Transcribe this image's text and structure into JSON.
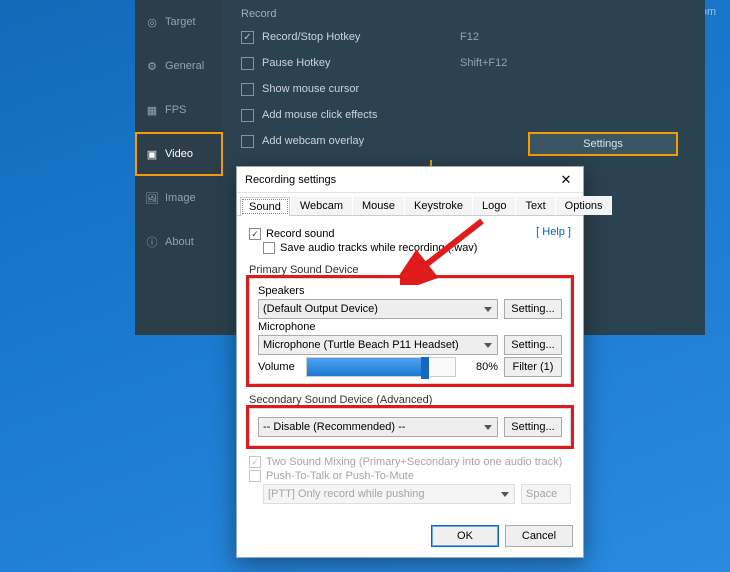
{
  "watermark": "www.bandicam.com",
  "sidebar": {
    "items": [
      {
        "label": "Target"
      },
      {
        "label": "General"
      },
      {
        "label": "FPS"
      },
      {
        "label": "Video"
      },
      {
        "label": "Image"
      },
      {
        "label": "About"
      }
    ]
  },
  "record_section": {
    "title": "Record",
    "rows": [
      {
        "label": "Record/Stop Hotkey",
        "value": "F12",
        "checked": true
      },
      {
        "label": "Pause Hotkey",
        "value": "Shift+F12",
        "checked": false
      },
      {
        "label": "Show mouse cursor",
        "value": "",
        "checked": false
      },
      {
        "label": "Add mouse click effects",
        "value": "",
        "checked": false
      },
      {
        "label": "Add webcam overlay",
        "value": "",
        "checked": false
      }
    ],
    "settings_button": "Settings"
  },
  "dialog": {
    "title": "Recording settings",
    "tabs": [
      "Sound",
      "Webcam",
      "Mouse",
      "Keystroke",
      "Logo",
      "Text",
      "Options"
    ],
    "active_tab": "Sound",
    "record_sound": "Record sound",
    "save_wav": "Save audio tracks while recording (.wav)",
    "help": "[ Help ]",
    "primary": {
      "title": "Primary Sound Device",
      "speakers_label": "Speakers",
      "speakers_value": "(Default Output Device)",
      "mic_label": "Microphone",
      "mic_value": "Microphone (Turtle Beach P11 Headset)",
      "volume_label": "Volume",
      "volume_pct": "80%",
      "setting": "Setting...",
      "filter": "Filter (1)"
    },
    "secondary": {
      "title": "Secondary Sound Device (Advanced)",
      "value": "-- Disable (Recommended) --",
      "setting": "Setting..."
    },
    "mixing": {
      "two_sound": "Two Sound Mixing (Primary+Secondary into one audio track)",
      "ptt": "Push-To-Talk or Push-To-Mute",
      "ptt_mode": "[PTT] Only record while pushing",
      "ptt_key": "Space"
    },
    "buttons": {
      "ok": "OK",
      "cancel": "Cancel"
    }
  },
  "chart_data": {
    "type": "none"
  }
}
